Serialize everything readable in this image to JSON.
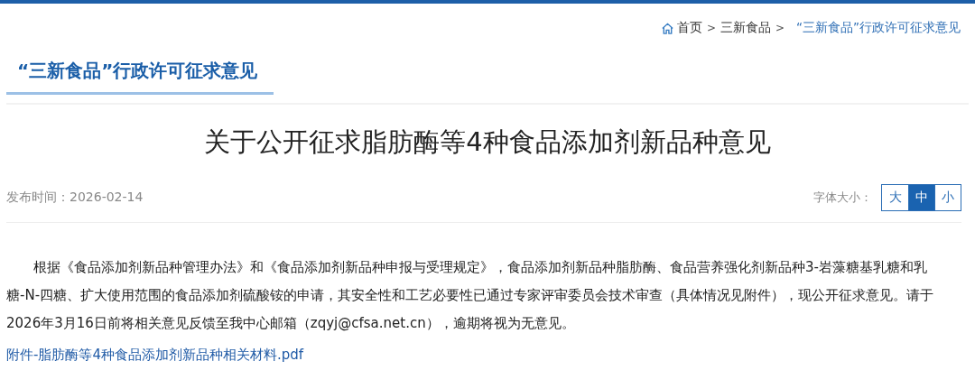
{
  "breadcrumb": [
    {
      "label": "首页",
      "kind": "link",
      "current": false
    },
    {
      "label": ">",
      "kind": "separator"
    },
    {
      "label": "三新食品",
      "kind": "link",
      "current": false
    },
    {
      "label": ">",
      "kind": "separator"
    },
    {
      "label": "“三新食品”行政许可征求意见",
      "kind": "link",
      "current": true
    }
  ],
  "section_title": "“三新食品”行政许可征求意见",
  "article": {
    "title": "关于公开征求脂肪酶等4种食品添加剂新品种意见",
    "publish_date": "发布时间：2026-02-14",
    "font_size": {
      "label": "字体大小：",
      "options": [
        {
          "label": "大",
          "selected": false
        },
        {
          "label": "中",
          "selected": true
        },
        {
          "label": "小",
          "selected": false
        }
      ]
    },
    "body": "根据《食品添加剂新品种管理办法》和《食品添加剂新品种申报与受理规定》，食品添加剂新品种脂肪酶、食品营养强化剂新品种3-岩藻糖基乳糖和乳糖-N-四糖、扩大使用范围的食品添加剂硫酸铵的申请，其安全性和工艺必要性已通过专家评审委员会技术审查（具体情况见附件），现公开征求意见。请于2026年3月16日前将相关意见反馈至我中心邮箱（zqyj@cfsa.net.cn），逾期将视为无意见。",
    "attachment": "附件-脂肪酶等4种食品添加剂新品种相关材料.pdf"
  }
}
